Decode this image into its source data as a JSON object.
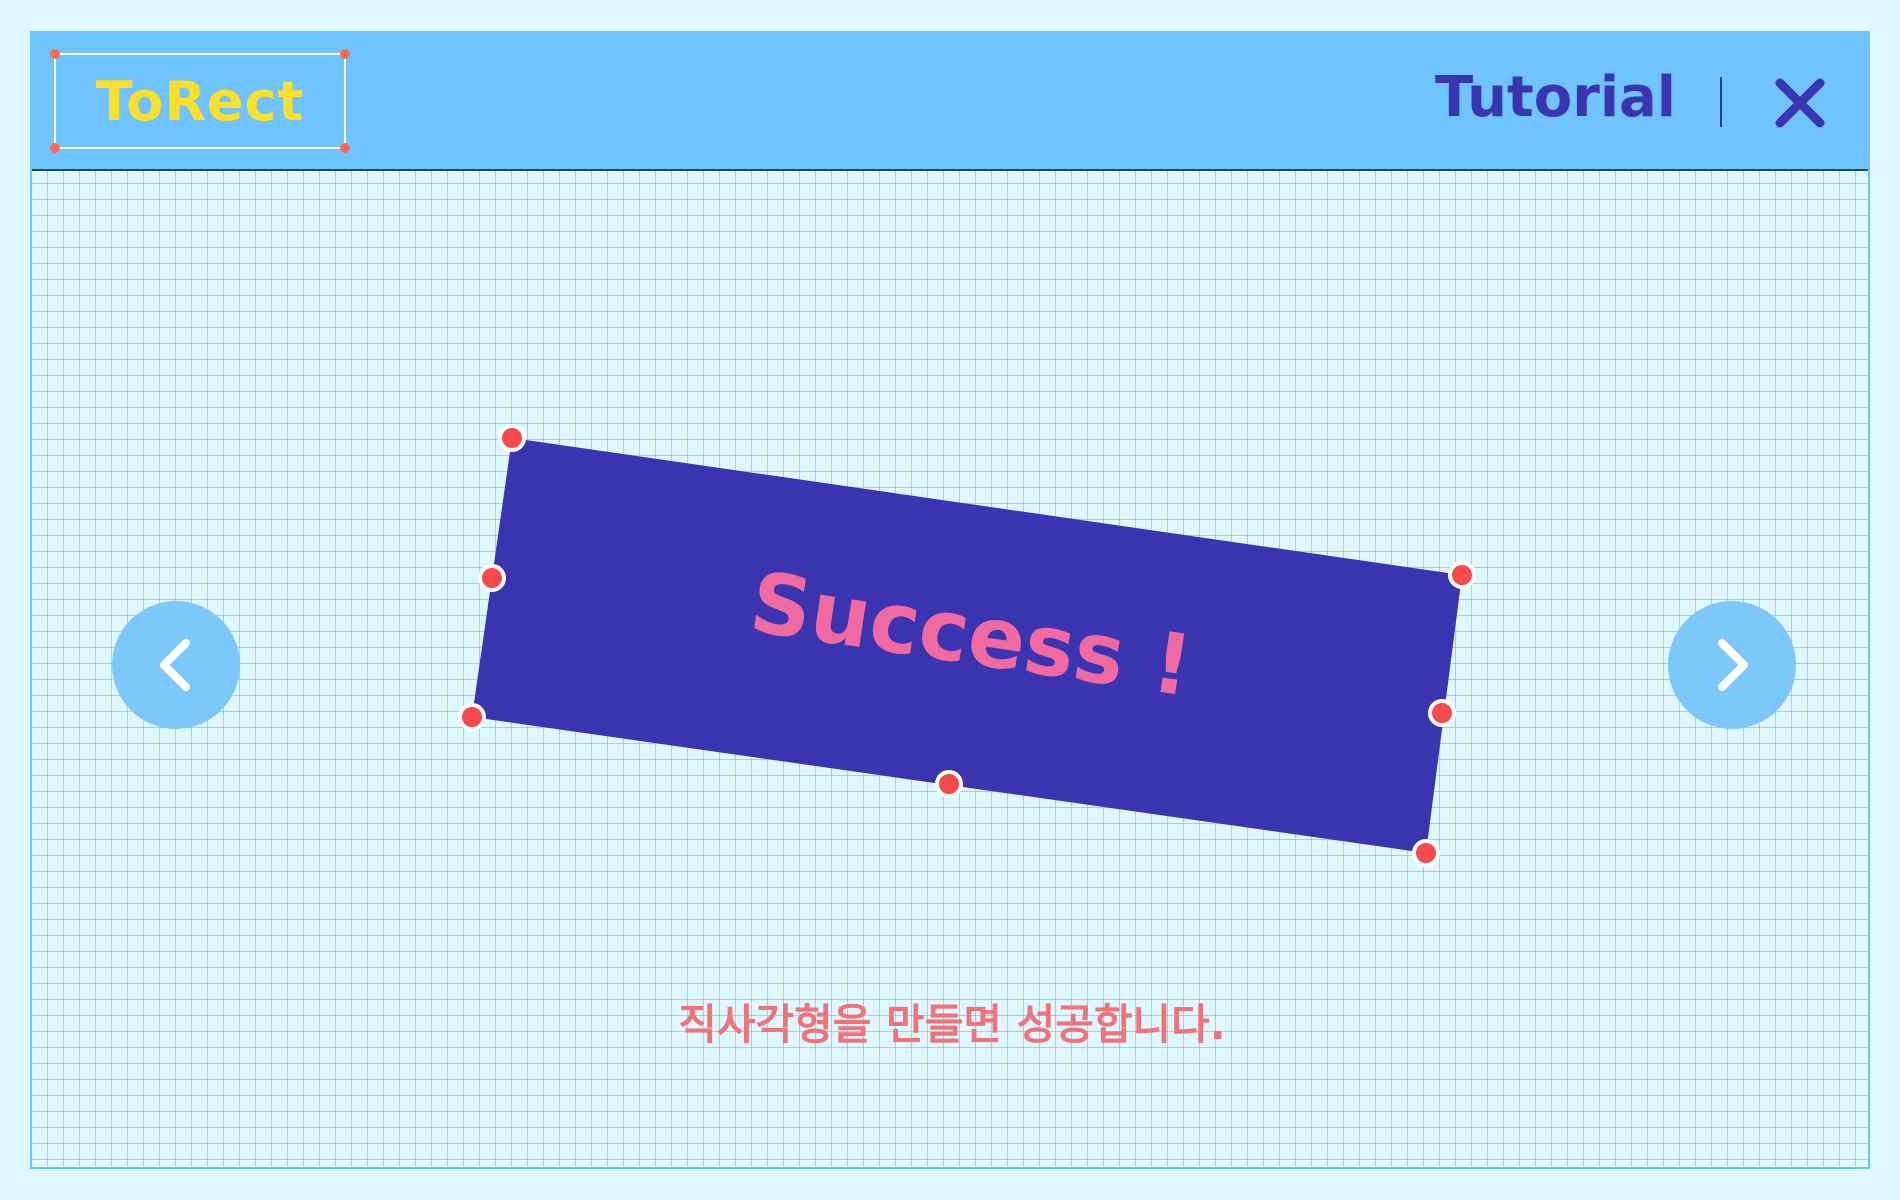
{
  "header": {
    "logo_text": "ToRect",
    "tutorial_label": "Tutorial",
    "close_icon": "close-icon"
  },
  "game": {
    "result_text": "Success !",
    "hint": "직사각형을 만들면 성공합니다.",
    "shape_rotation_deg": 8.5
  },
  "navigation": {
    "prev_icon": "chevron-left-icon",
    "next_icon": "chevron-right-icon"
  },
  "colors": {
    "background": "#dff7fe",
    "grid_line": "#5ab9eb",
    "header": "#6fc3fe",
    "logo": "#fcdf2b",
    "accent_dark": "#3b34b0",
    "shape_fill": "#3b34b0",
    "success_text": "#ee6aa0",
    "handle": "#f54a4e",
    "hint_text": "#f2727a",
    "nav_button": "#7cc8fb"
  }
}
